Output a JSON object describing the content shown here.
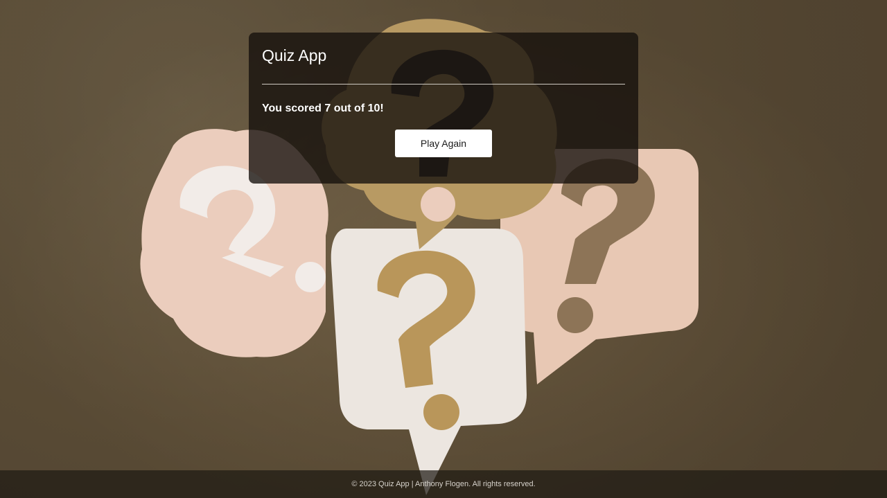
{
  "app": {
    "title": "Quiz App"
  },
  "result": {
    "score_text": "You scored 7 out of 10!",
    "score": 7,
    "total": 10
  },
  "actions": {
    "play_again_label": "Play Again"
  },
  "footer": {
    "text": "© 2023 Quiz App | Anthony Flogen. All rights reserved."
  },
  "colors": {
    "background": "#6e5d44",
    "card": "#14100c",
    "button": "#ffffff",
    "text": "#ffffff"
  }
}
